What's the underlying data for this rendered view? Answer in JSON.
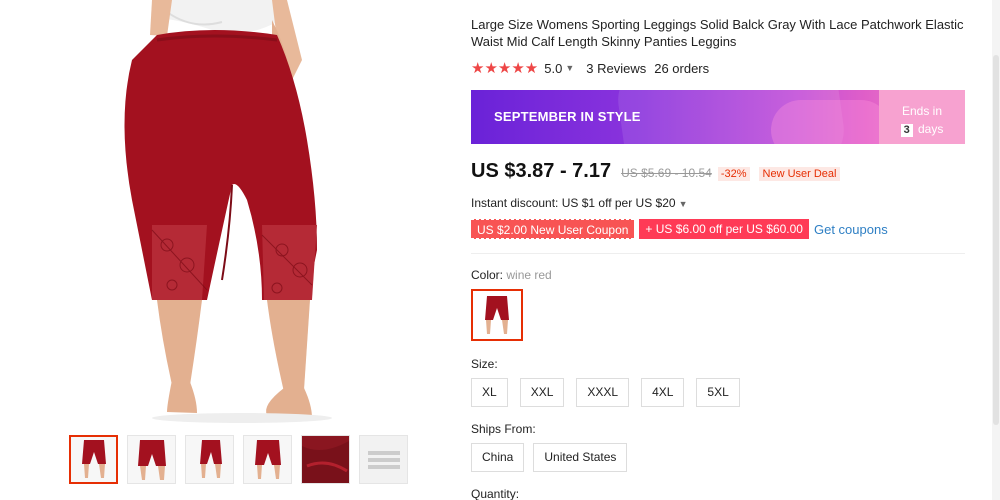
{
  "product": {
    "title": "Large Size Womens Sporting Leggings Solid Balck Gray With Lace Patchwork Elastic Waist Mid Calf Length Skinny Panties Leggins",
    "stars": "★★★★★",
    "rating": "5.0",
    "reviews": "3 Reviews",
    "orders": "26 orders"
  },
  "banner": {
    "text": "SEPTEMBER IN STYLE",
    "ends_in": "Ends in",
    "days_count": "3",
    "days_label": "days"
  },
  "price": {
    "current": "US $3.87 - 7.17",
    "original": "US $5.69 - 10.54",
    "discount": "-32%",
    "deal": "New User Deal"
  },
  "instant_discount": "Instant discount: US $1 off per US $20",
  "coupons": {
    "items": [
      "US $2.00 New User Coupon",
      "+ US $6.00 off per US $60.00"
    ],
    "get_link": "Get coupons"
  },
  "color": {
    "label": "Color:",
    "value": "wine red"
  },
  "size": {
    "label": "Size:",
    "options": [
      "XL",
      "XXL",
      "XXXL",
      "4XL",
      "5XL"
    ]
  },
  "ships": {
    "label": "Ships From:",
    "options": [
      "China",
      "United States"
    ]
  },
  "quantity": {
    "label": "Quantity:"
  },
  "colors": {
    "accent": "#e62e04",
    "star": "#ee4646",
    "link": "#2e7fc4",
    "product": "#a3111f"
  },
  "icons": {
    "rating_chevron": "chevron-down-icon",
    "instant_chevron": "chevron-down-icon"
  }
}
